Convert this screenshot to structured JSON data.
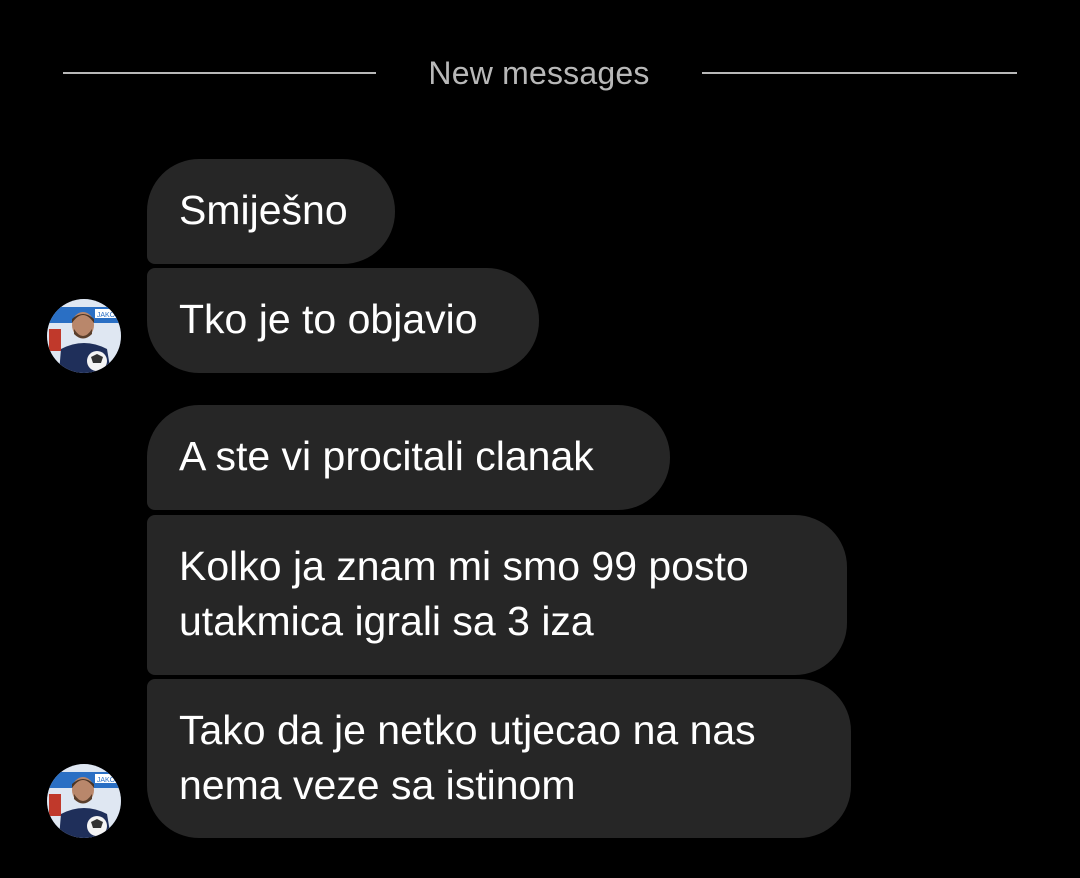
{
  "divider": {
    "label": "New messages"
  },
  "messages": [
    {
      "lines": [
        "Smiješno"
      ]
    },
    {
      "lines": [
        "Tko je to objavio"
      ]
    },
    {
      "lines": [
        "A ste vi procitali clanak"
      ]
    },
    {
      "lines": [
        "Kolko ja znam mi smo 99 posto",
        "utakmica igrali sa 3 iza"
      ]
    },
    {
      "lines": [
        "Tako da je netko utjecao na nas",
        "nema veze sa istinom"
      ]
    }
  ],
  "avatar": {
    "icon": "contact-avatar-photo",
    "badge_text": "JAKO",
    "colors": {
      "jersey": "#1f2f5a",
      "banner": "#2a6fc4",
      "skin": "#b9876b"
    }
  },
  "colors": {
    "background": "#000000",
    "bubble": "#262626",
    "text": "#ffffff",
    "divider": "#b8b8b8"
  }
}
